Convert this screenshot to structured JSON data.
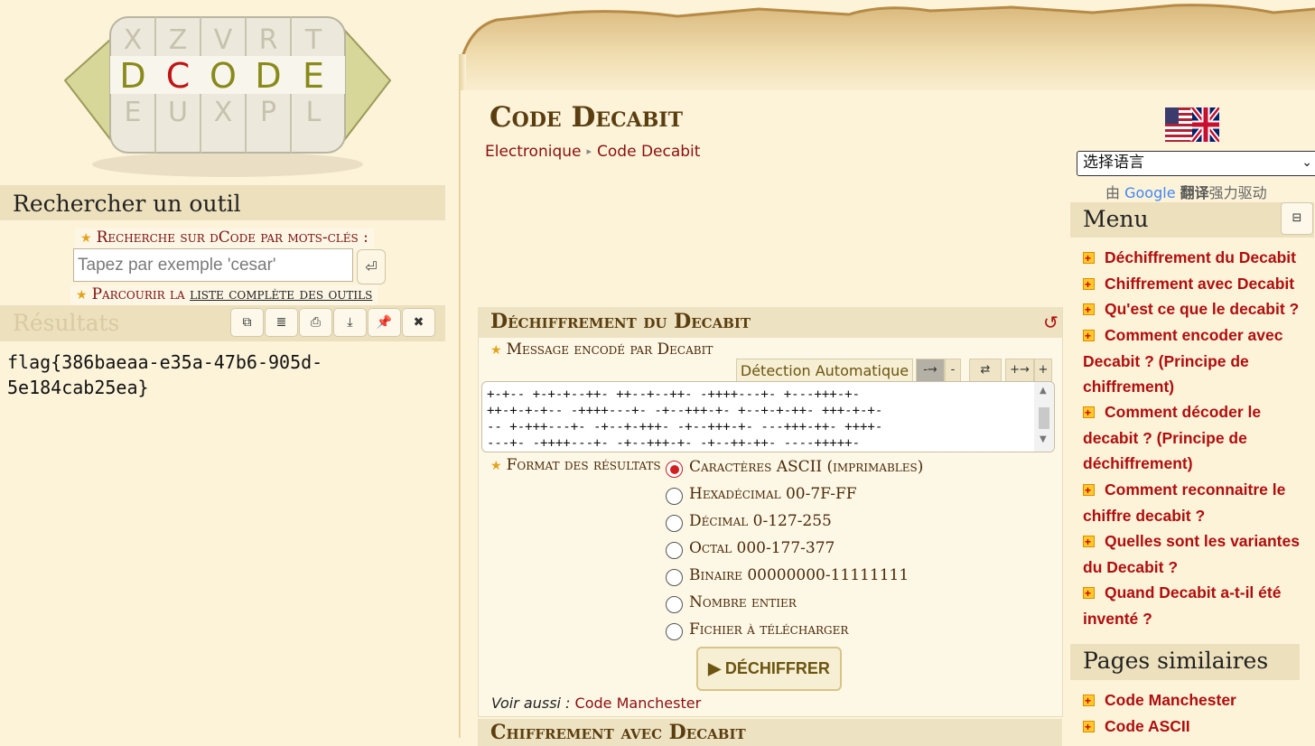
{
  "left": {
    "search_title": "Rechercher un outil",
    "keyword_label": "Recherche sur dCode par mots-clés :",
    "search_placeholder": "Tapez par exemple 'cesar'",
    "search_button": "⏎",
    "browse_prefix": "Parcourir la",
    "browse_link": "liste complète des outils",
    "results_title": "Résultats",
    "result_value": "flag{386baeaa-e35a-47b6-905d-5e184cab25ea}"
  },
  "logo": {
    "letters": "DCODE"
  },
  "main": {
    "title": "Code Decabit",
    "breadcrumb": [
      "Electronique",
      "Code Decabit"
    ],
    "decrypt_section_title": "Déchiffrement du Decabit",
    "message_label": "Message encodé par Decabit",
    "detect_button": "Détection Automatique",
    "tool_buttons": [
      "-→",
      "-",
      "⇄",
      "+→",
      "+"
    ],
    "input_lines": [
      "+-+-- +-+-+--++- ++--+--++- -++++---+- +---+++-+-",
      "++-+-+-+-- -++++---+- -+--+++-+- +--+-+-++- +++-+-+-",
      "-- +-+++---+- -+--+-+++- -+--+++-+- ---+++-++- ++++-",
      "---+- -++++---+- -+--+++-+- -+--++-++- ----+++++-"
    ],
    "format_label": "Format des résultats",
    "format_options": [
      "Caractères ASCII (imprimables)",
      "Hexadécimal 00-7F-FF",
      "Décimal 0-127-255",
      "Octal 000-177-377",
      "Binaire 00000000-11111111",
      "Nombre entier",
      "Fichier à télécharger"
    ],
    "selected_format": "Caractères ASCII (imprimables)",
    "decrypt_button": "▶ DÉCHIFFRER",
    "see_also_label": "Voir aussi :",
    "see_also_link": "Code Manchester",
    "encrypt_section_title": "Chiffrement avec Decabit"
  },
  "right": {
    "language_select": "选择语言",
    "powered_prefix": "由",
    "powered_google": "Google",
    "powered_translate": "翻译",
    "powered_suffix": "强力驱动",
    "menu_title": "Menu",
    "menu_toggle": "⊟",
    "menu_items": [
      "Déchiffrement du Decabit",
      "Chiffrement avec Decabit",
      "Qu'est ce que le decabit ?",
      "Comment encoder avec Decabit ? (Principe de chiffrement)",
      "Comment décoder le decabit ? (Principe de déchiffrement)",
      "Comment reconnaitre le chiffre decabit ?",
      "Quelles sont les variantes du Decabit ?",
      "Quand Decabit a-t-il été inventé ?"
    ],
    "similar_title": "Pages similaires",
    "similar_items": [
      "Code Manchester",
      "Code ASCII"
    ]
  },
  "colors": {
    "background": "#fcf3d9",
    "link_red": "#b00e0e",
    "title_brown": "#5b3e10",
    "section_bar": "#ede2c2"
  }
}
